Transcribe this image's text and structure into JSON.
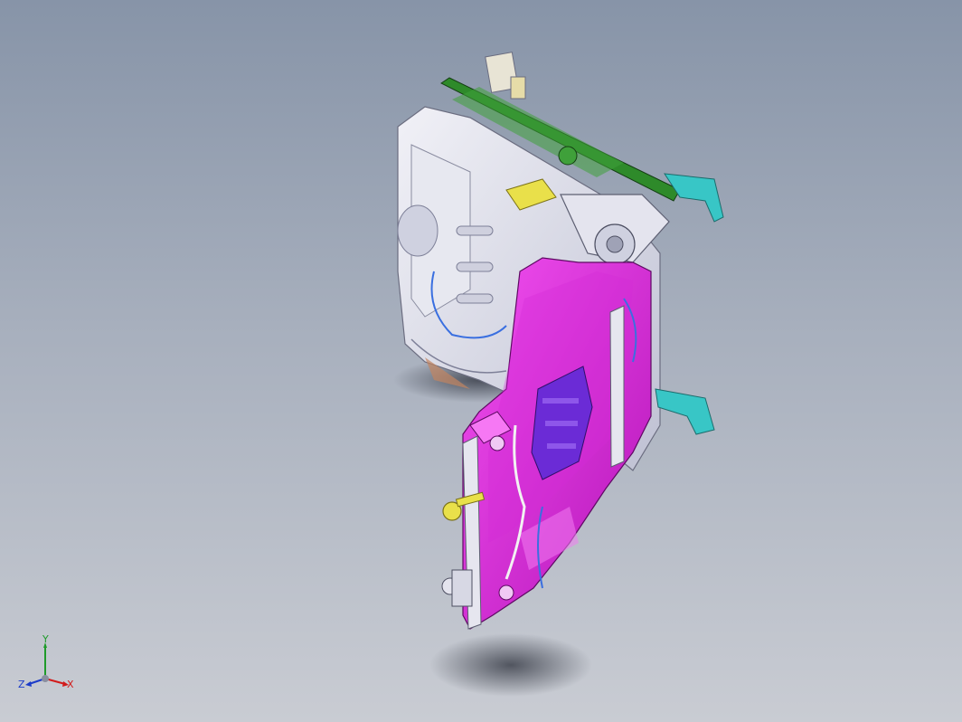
{
  "app": {
    "type": "CAD 3D model viewport"
  },
  "colors": {
    "background_top": "#8794a8",
    "background_bottom": "#c9ccd3",
    "seat_back_frame": "#dcdde8",
    "seat_cushion_frame": "#e12fe0",
    "slide_rail": "#2e8a2a",
    "bracket_cyan": "#38c6c6",
    "mechanism_purple": "#6b2bd6",
    "connector_yellow": "#e9e04a",
    "harness_blue": "#3a6fe0"
  },
  "triad": {
    "x_label": "X",
    "y_label": "Y",
    "z_label": "Z"
  }
}
